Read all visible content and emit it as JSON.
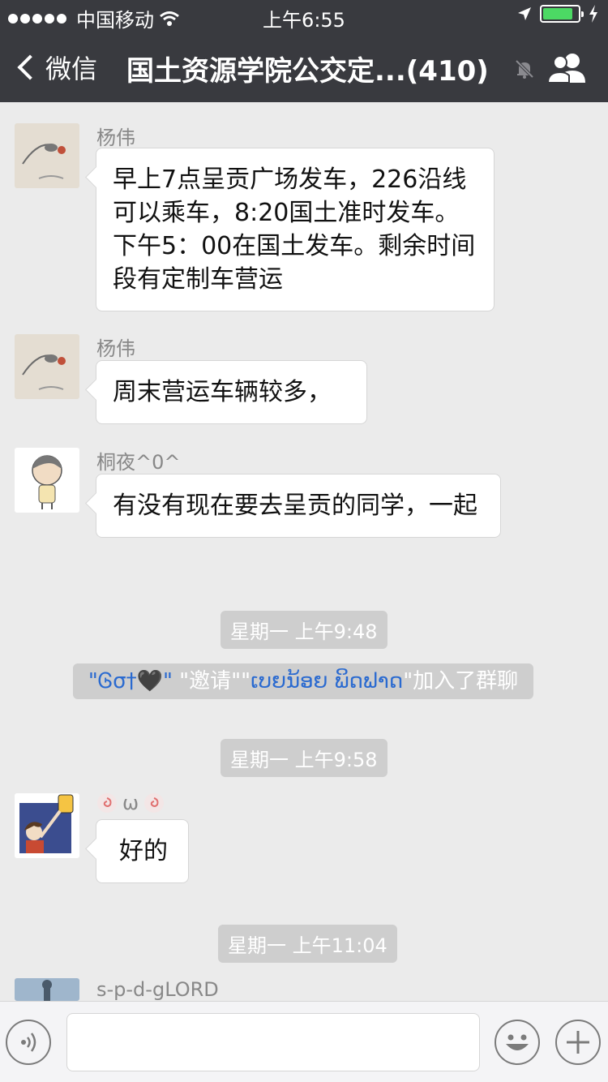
{
  "status_bar": {
    "carrier": "中国移动",
    "time": "上午6:55",
    "battery_level": 0.85
  },
  "nav": {
    "back_label": "微信",
    "title": "国土资源学院公交定...(410)"
  },
  "messages": [
    {
      "sender": "杨伟",
      "text": "早上7点呈贡广场发车，226沿线可以乘车，8:20国土准时发车。下午5：00在国土发车。剩余时间段有定制车营运"
    },
    {
      "sender": "杨伟",
      "text": "周末营运车辆较多，"
    },
    {
      "sender": "桐夜^0^",
      "text": "有没有现在要去呈贡的同学，一起"
    },
    {
      "timestamp": "星期一 上午9:48"
    },
    {
      "system": {
        "inviter": "\"Ꮆσ†🖤\"",
        "verb": " \"邀请\"",
        "invitee": "ເບຍນ້ອຍ ພິດຟາດ",
        "tail": "\"加入了群聊"
      }
    },
    {
      "timestamp": "星期一 上午9:58"
    },
    {
      "sender": "ω",
      "text": "好的"
    },
    {
      "timestamp": "星期一 上午11:04"
    },
    {
      "sender": "s-p-d-gLORD"
    }
  ]
}
